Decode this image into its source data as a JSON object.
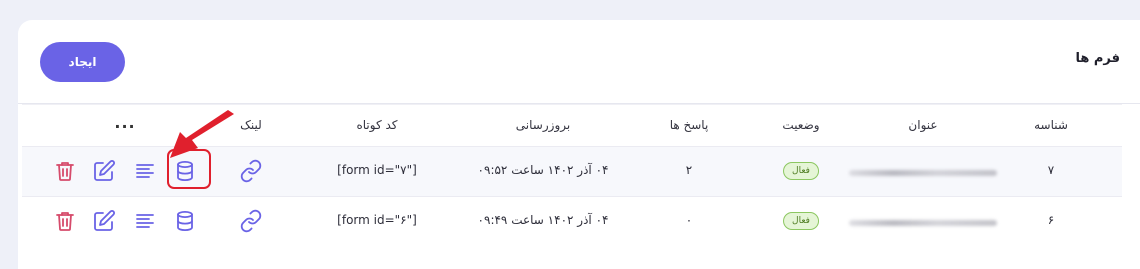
{
  "header": {
    "title": "فرم ها",
    "create_label": "ایجاد"
  },
  "table": {
    "columns": {
      "id": "شناسه",
      "title": "عنوان",
      "status": "وضعیت",
      "responses": "پاسخ ها",
      "updated": "بروزرسانی",
      "shortcode": "کد کوتاه",
      "link": "لینک",
      "more": "..."
    },
    "rows": [
      {
        "id": "۷",
        "status": "فعال",
        "responses": "۲",
        "updated": "۰۴ آذر ۱۴۰۲ ساعت ۰۹:۵۲",
        "shortcode": "[form id=\"۷\"]"
      },
      {
        "id": "۶",
        "status": "فعال",
        "responses": "۰",
        "updated": "۰۴ آذر ۱۴۰۲ ساعت ۰۹:۴۹",
        "shortcode": "[form id=\"۶\"]"
      }
    ]
  },
  "icons": {
    "link": "link-icon",
    "entries": "database-icon",
    "details": "list-icon",
    "edit": "edit-icon",
    "delete": "trash-icon"
  },
  "colors": {
    "accent": "#6a63e6",
    "icon": "#6a63e6",
    "delete": "#d64b6b",
    "badge_bg": "#e5f5d6",
    "badge_text": "#4c7b1f",
    "highlight": "#e0202d"
  }
}
